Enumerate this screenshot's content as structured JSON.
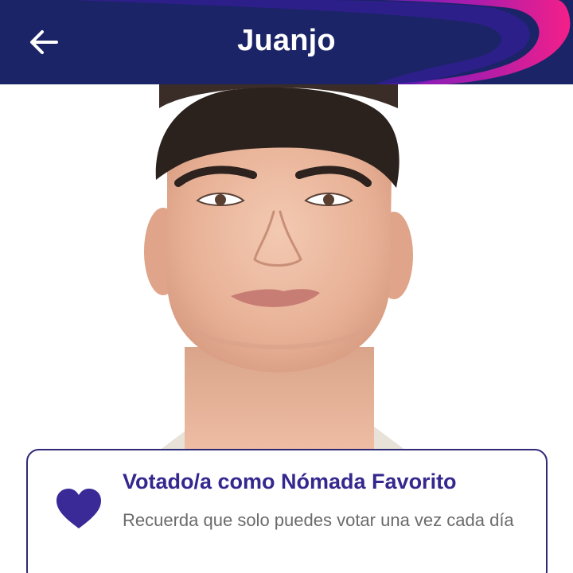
{
  "header": {
    "title": "Juanjo",
    "back_icon": "arrow-left-icon",
    "background_color": "#1b2466",
    "accent_colors": [
      "#6a1fd0",
      "#d81c9a",
      "#ff1e8c"
    ]
  },
  "profile": {
    "photo_description_icon": "portrait-photo"
  },
  "vote_card": {
    "icon": "heart-icon",
    "icon_color": "#3a2a97",
    "title": "Votado/a como Nómada Favorito",
    "message": "Recuerda que solo puedes votar una vez cada día",
    "border_color": "#2e2a78"
  }
}
